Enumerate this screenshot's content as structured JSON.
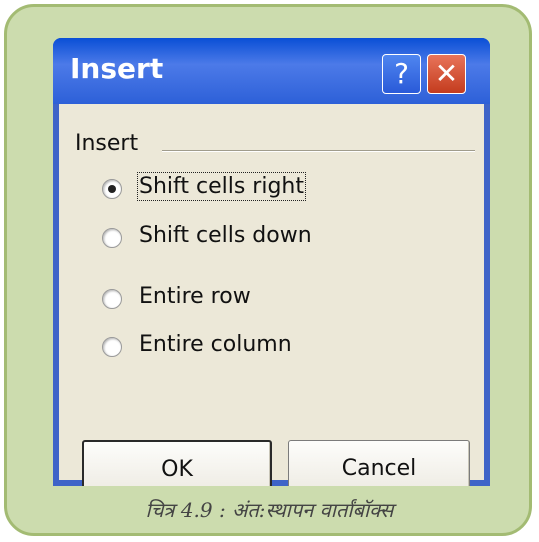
{
  "dialog": {
    "title": "Insert",
    "help_button": "?",
    "close_button": "✕",
    "group_label": "Insert",
    "options": [
      {
        "label": "Shift cells right",
        "selected": true
      },
      {
        "label": "Shift cells down",
        "selected": false
      },
      {
        "label": "Entire row",
        "selected": false
      },
      {
        "label": "Entire column",
        "selected": false
      }
    ],
    "ok_label": "OK",
    "cancel_label": "Cancel"
  },
  "caption": "चित्र 4.9 : अंत:स्थापन वार्तांबॉक्स",
  "colors": {
    "frame_bg": "#ccdcae",
    "frame_border": "#a3bb73",
    "titlebar": "#2d60d8",
    "client_bg": "#ece8d8",
    "close_red": "#c43c1e"
  }
}
